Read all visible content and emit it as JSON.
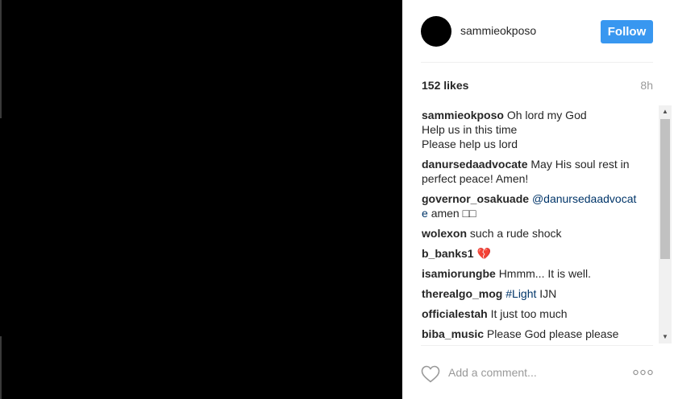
{
  "post": {
    "username": "sammieokposo",
    "follow_label": "Follow",
    "likes": "152 likes",
    "time": "8h"
  },
  "comments": [
    {
      "user": "sammieokposo",
      "lines": [
        "Oh lord my God",
        "Help us in this time",
        "Please help us lord"
      ]
    },
    {
      "user": "danursedaadvocate",
      "text": "May His soul rest in perfect peace! Amen!"
    },
    {
      "user": "governor_osakuade",
      "mention": "@danursedaadvocate",
      "text": "amen □□"
    },
    {
      "user": "wolexon",
      "text": "such a rude shock"
    },
    {
      "user": "b_banks1",
      "text": "💔"
    },
    {
      "user": "isamiorungbe",
      "text": "Hmmm... It is well."
    },
    {
      "user": "therealgo_mog",
      "hashtag": "#Light",
      "text": "IJN"
    },
    {
      "user": "officialestah",
      "text": "It just too much"
    },
    {
      "user": "biba_music",
      "text": "Please God please please"
    }
  ],
  "add_comment": {
    "placeholder": "Add a comment..."
  },
  "icons": {
    "like": "heart-outline-icon",
    "more": "more-options-icon",
    "scroll_up": "scroll-up-arrow",
    "scroll_down": "scroll-down-arrow"
  },
  "colors": {
    "follow_button": "#3897f0",
    "link": "#003569",
    "muted": "#999999"
  }
}
